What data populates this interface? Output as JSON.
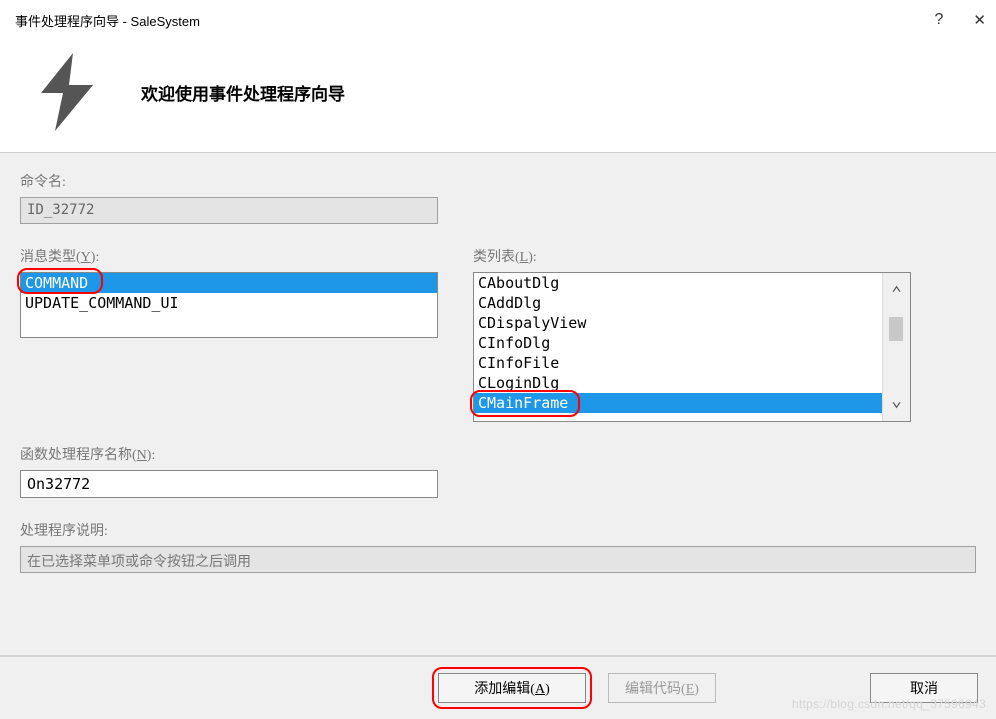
{
  "window": {
    "title": "事件处理程序向导 - SaleSystem",
    "help_icon": "?",
    "close_icon": "✕"
  },
  "header": {
    "welcome_title": "欢迎使用事件处理程序向导"
  },
  "labels": {
    "command_name": "命令名:",
    "message_type": "消息类型(",
    "message_type_key": "Y",
    "message_type_suffix": "):",
    "class_list": "类列表(",
    "class_list_key": "L",
    "class_list_suffix": "):",
    "handler_name": "函数处理程序名称(",
    "handler_name_key": "N",
    "handler_name_suffix": "):",
    "handler_desc": "处理程序说明:"
  },
  "fields": {
    "command_name_value": "ID_32772",
    "handler_name_value": "On32772",
    "handler_desc_value": "在已选择菜单项或命令按钮之后调用"
  },
  "message_types": {
    "items": [
      "COMMAND",
      "UPDATE_COMMAND_UI"
    ],
    "selected": 0
  },
  "class_list": {
    "items": [
      "CAboutDlg",
      "CAddDlg",
      "CDispalyView",
      "CInfoDlg",
      "CInfoFile",
      "CLoginDlg",
      "CMainFrame"
    ],
    "selected": 6
  },
  "buttons": {
    "add_edit": "添加编辑(",
    "add_edit_key": "A",
    "add_edit_suffix": ")",
    "edit_code": "编辑代码(",
    "edit_code_key": "E",
    "edit_code_suffix": ")",
    "cancel": "取消"
  },
  "watermark": "https://blog.csdn.net/qq_37596943"
}
